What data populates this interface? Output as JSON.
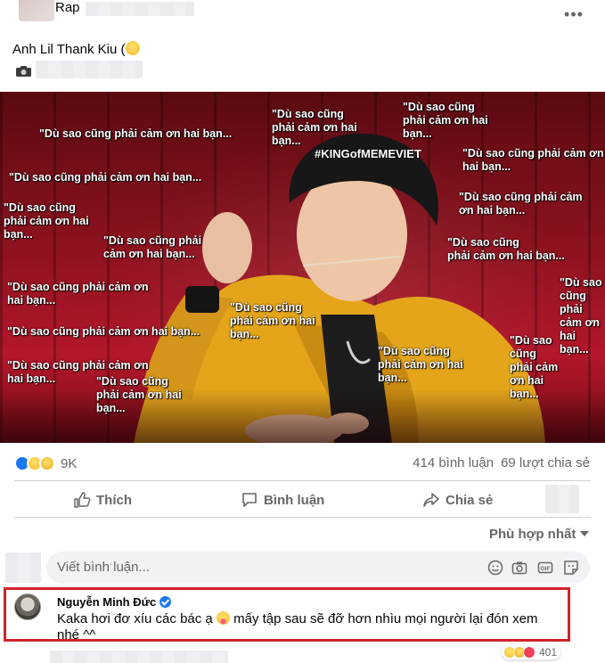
{
  "post": {
    "page_name": "Rap",
    "caption": "Anh Lil Thank Kiu (",
    "more_icon": "more-horizontal-icon"
  },
  "meme": {
    "hashtag": "#KINGofMEMEVIET",
    "captions": [
      "\"Dù sao cũng\nphải cảm ơn hai\nbạn...",
      "\"Dù sao cũng\nphải cảm ơn hai\nbạn...",
      "\"Dù sao cũng phải cảm ơn hai bạn...",
      "\"Dù sao cũng phải cảm ơn\nhai bạn...",
      "\"Dù sao cũng phải cảm ơn hai bạn...",
      "\"Dù sao cũng phải cảm\nơn hai bạn...",
      "\"Dù sao cũng\nphải cảm ơn hai\nbạn...",
      "\"Dù sao cũng phải\ncảm ơn hai bạn...",
      "\"Dù sao cũng\nphải cảm ơn hai bạn...",
      "\"Dù sao cũng phải cảm ơn\nhai bạn...",
      "\"Dù sao cũng\nphải cảm ơn hai\nbạn...",
      "\"Dù sao cũng phải cảm ơn hai bạn...",
      "\"Dù sao\ncũng\nphải\ncảm ơn\nhai\nbạn...",
      "\"Dù sao cũng phải cảm ơn\nhai bạn...",
      "\"Dù sao cũng\nphải cảm ơn hai\nbạn...",
      "\"Dù sao cũng\nphải cảm ơn hai\nbạn...",
      "\"Dù sao\ncũng\nphải cảm\nơn hai\nbạn..."
    ]
  },
  "engagement": {
    "reaction_count": "9K",
    "comments": "414 bình luận",
    "shares": "69 lượt chia sẻ"
  },
  "actions": {
    "like": "Thích",
    "comment": "Bình luận",
    "share": "Chia sẻ"
  },
  "sort": {
    "label": "Phù hợp nhất"
  },
  "comment_input": {
    "placeholder": "Viết bình luận..."
  },
  "top_comment": {
    "author": "Nguyễn Minh Đức",
    "text_before": "Kaka hơi đơ xíu các bác ạ ",
    "text_after": " mấy tập sau sẽ đỡ hơn nhìu mọi người lại đón xem nhé ^^",
    "reaction_count": "401"
  },
  "colors": {
    "accent": "#1877f2",
    "highlight_border": "#d2232a",
    "secondary_text": "#65676b"
  }
}
